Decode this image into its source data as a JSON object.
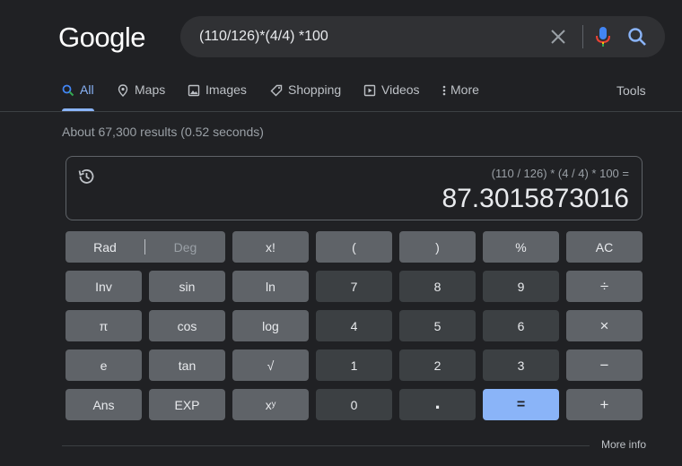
{
  "logo": "Google",
  "search": {
    "query": "(110/126)*(4/4) *100"
  },
  "tabs": [
    {
      "label": "All",
      "icon": "search-icon",
      "active": true
    },
    {
      "label": "Maps",
      "icon": "map-pin-icon"
    },
    {
      "label": "Images",
      "icon": "image-icon"
    },
    {
      "label": "Shopping",
      "icon": "tag-icon"
    },
    {
      "label": "Videos",
      "icon": "play-icon"
    },
    {
      "label": "More",
      "icon": "dots-vertical-icon"
    }
  ],
  "tools_label": "Tools",
  "stats": "About 67,300 results (0.52 seconds)",
  "calculator": {
    "expression": "(110 / 126) * (4 / 4) * 100 =",
    "result": "87.3015873016",
    "rad_label": "Rad",
    "deg_label": "Deg",
    "keys": [
      [
        "x!",
        "(",
        ")",
        "%",
        "AC"
      ],
      [
        "Inv",
        "sin",
        "ln",
        "7",
        "8",
        "9",
        "÷"
      ],
      [
        "π",
        "cos",
        "log",
        "4",
        "5",
        "6",
        "×"
      ],
      [
        "e",
        "tan",
        "√",
        "1",
        "2",
        "3",
        "−"
      ],
      [
        "Ans",
        "EXP",
        "xʸ",
        "0",
        ".",
        "=",
        "+"
      ]
    ]
  },
  "more_info": "More info",
  "colors": {
    "background": "#202124",
    "accent": "#8ab4f8",
    "fn_key": "#5f6368",
    "num_key": "#3c4043"
  }
}
